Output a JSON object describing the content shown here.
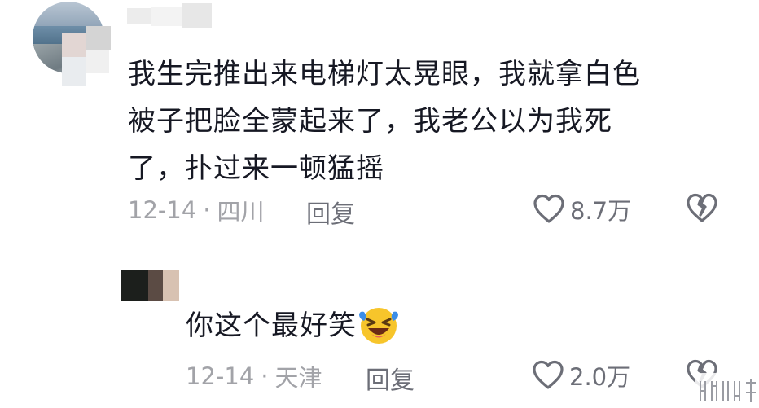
{
  "comments": [
    {
      "text": "我生完推出来电梯灯太晃眼，我就拿白色\n被子把脸全蒙起来了，我老公以为我死\n了，扑过来一顿猛摇",
      "date": "12-14",
      "separator": "·",
      "location": "四川",
      "reply_label": "回复",
      "likes": "8.7万",
      "icons": {
        "like": "heart-icon",
        "dislike": "broken-heart-icon"
      }
    },
    {
      "text": "你这个最好笑",
      "emoji": "rolling-laughing-emoji",
      "date": "12-14",
      "separator": "·",
      "location": "天津",
      "reply_label": "回复",
      "likes": "2.0万",
      "icons": {
        "like": "heart-icon",
        "dislike": "broken-heart-icon"
      }
    }
  ],
  "colors": {
    "text_primary": "#161823",
    "text_meta": "#a2a3a8",
    "text_action": "#6c6e77",
    "emoji_yellow": "#f7c52b",
    "emoji_blue": "#3b8de8"
  }
}
